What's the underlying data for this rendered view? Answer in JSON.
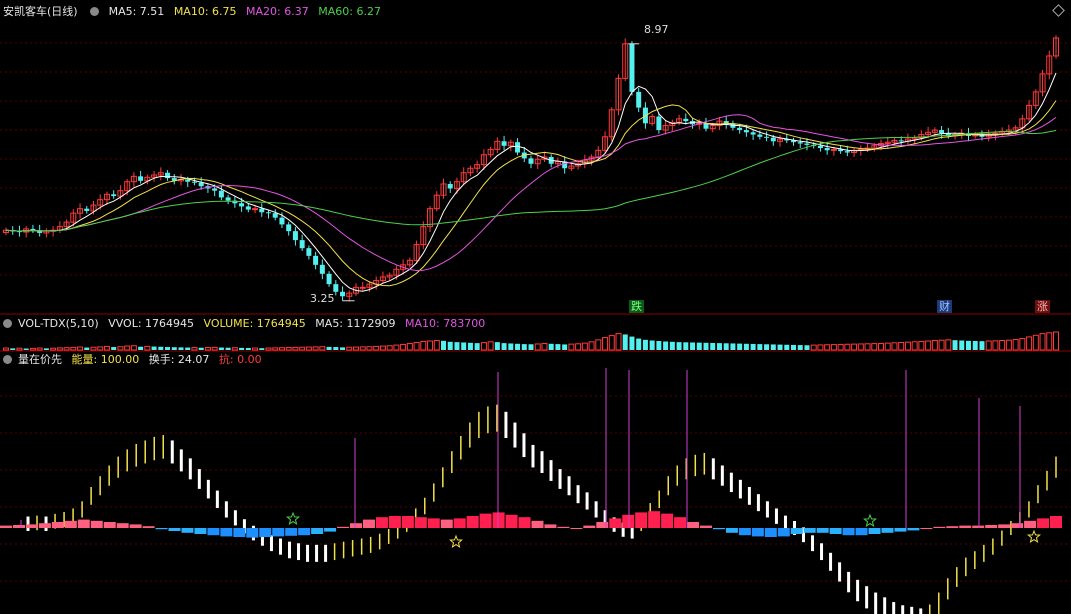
{
  "header": {
    "title": "安凯客车(日线)",
    "ma5": "MA5: 7.51",
    "ma10": "MA10: 6.75",
    "ma20": "MA20: 6.37",
    "ma60": "MA60: 6.27"
  },
  "volume_header": {
    "name": "VOL-TDX(5,10)",
    "vvol": "VVOL: 1764945",
    "volume": "VOLUME: 1764945",
    "ma5": "MA5: 1172909",
    "ma10": "MA10: 783700"
  },
  "indicator_header": {
    "name": "量在价先",
    "energy": "能量: 100.00",
    "turnover": "换手: 24.07",
    "kang": "抗: 0.00"
  },
  "price_annotations": {
    "high": "8.97",
    "low": "3.25"
  },
  "tags": {
    "die": "跌",
    "cai": "财",
    "zhang": "涨"
  },
  "colors": {
    "up": "#ff3b3b",
    "down": "#54f0f0",
    "ma5": "#ffffff",
    "ma10": "#f2e24a",
    "ma20": "#e455e4",
    "ma60": "#4cd04c",
    "grid": "#5a0000",
    "sep": "#8a0000"
  },
  "chart_data": [
    {
      "type": "candlestick",
      "title": "安凯客车(日线)",
      "ylim": [
        3.0,
        9.5
      ],
      "min_price": 3.25,
      "max_price": 8.97,
      "closes": [
        4.82,
        4.8,
        4.78,
        4.85,
        4.82,
        4.76,
        4.8,
        4.82,
        4.9,
        5.0,
        5.2,
        5.3,
        5.25,
        5.38,
        5.5,
        5.62,
        5.58,
        5.7,
        5.9,
        6.02,
        5.92,
        6.0,
        6.05,
        6.1,
        5.98,
        5.92,
        5.95,
        5.9,
        5.88,
        5.8,
        5.75,
        5.7,
        5.55,
        5.48,
        5.42,
        5.35,
        5.28,
        5.3,
        5.22,
        5.2,
        5.1,
        4.95,
        4.8,
        4.6,
        4.42,
        4.25,
        4.05,
        3.85,
        3.62,
        3.45,
        3.35,
        3.42,
        3.55,
        3.55,
        3.62,
        3.7,
        3.78,
        3.82,
        3.95,
        4.05,
        4.15,
        4.5,
        4.9,
        5.3,
        5.6,
        5.85,
        5.75,
        5.9,
        6.1,
        6.2,
        6.28,
        6.5,
        6.62,
        6.8,
        6.7,
        6.78,
        6.55,
        6.42,
        6.3,
        6.4,
        6.45,
        6.3,
        6.35,
        6.2,
        6.25,
        6.3,
        6.38,
        6.45,
        6.6,
        6.9,
        7.5,
        8.2,
        8.97,
        7.9,
        7.55,
        7.2,
        7.35,
        7.05,
        7.15,
        7.22,
        7.3,
        7.25,
        7.18,
        7.2,
        7.08,
        7.15,
        7.25,
        7.2,
        7.1,
        7.05,
        7.0,
        6.95,
        6.9,
        6.88,
        6.8,
        6.85,
        6.82,
        6.78,
        6.75,
        6.72,
        6.7,
        6.65,
        6.6,
        6.62,
        6.58,
        6.55,
        6.6,
        6.62,
        6.65,
        6.7,
        6.75,
        6.78,
        6.82,
        6.8,
        6.85,
        6.88,
        6.95,
        7.0,
        7.05,
        6.98,
        6.92,
        6.95,
        6.98,
        6.92,
        6.95,
        6.9,
        6.94,
        6.98,
        7.02,
        7.05,
        7.1,
        7.3,
        7.6,
        7.9,
        8.3,
        8.7,
        9.1
      ]
    },
    {
      "type": "bar",
      "title": "VOL-TDX(5,10)",
      "series": [
        {
          "name": "VOLUME",
          "values": [
            0.12,
            0.1,
            0.11,
            0.09,
            0.1,
            0.12,
            0.1,
            0.11,
            0.13,
            0.14,
            0.16,
            0.18,
            0.15,
            0.17,
            0.19,
            0.22,
            0.18,
            0.2,
            0.24,
            0.26,
            0.2,
            0.22,
            0.21,
            0.2,
            0.18,
            0.17,
            0.16,
            0.15,
            0.15,
            0.14,
            0.15,
            0.16,
            0.15,
            0.14,
            0.14,
            0.13,
            0.12,
            0.12,
            0.11,
            0.12,
            0.13,
            0.14,
            0.15,
            0.16,
            0.17,
            0.18,
            0.19,
            0.2,
            0.19,
            0.18,
            0.16,
            0.17,
            0.18,
            0.19,
            0.2,
            0.22,
            0.24,
            0.26,
            0.3,
            0.34,
            0.4,
            0.46,
            0.52,
            0.55,
            0.58,
            0.56,
            0.5,
            0.48,
            0.46,
            0.44,
            0.42,
            0.45,
            0.5,
            0.48,
            0.42,
            0.4,
            0.38,
            0.36,
            0.35,
            0.37,
            0.4,
            0.38,
            0.36,
            0.34,
            0.36,
            0.38,
            0.42,
            0.5,
            0.62,
            0.76,
            0.88,
            1.0,
            0.95,
            0.82,
            0.7,
            0.62,
            0.58,
            0.55,
            0.52,
            0.5,
            0.48,
            0.47,
            0.46,
            0.45,
            0.44,
            0.43,
            0.42,
            0.41,
            0.4,
            0.39,
            0.38,
            0.37,
            0.36,
            0.35,
            0.34,
            0.33,
            0.32,
            0.31,
            0.3,
            0.29,
            0.3,
            0.31,
            0.32,
            0.33,
            0.34,
            0.35,
            0.36,
            0.37,
            0.38,
            0.39,
            0.4,
            0.42,
            0.44,
            0.46,
            0.48,
            0.5,
            0.52,
            0.55,
            0.58,
            0.6,
            0.62,
            0.6,
            0.58,
            0.56,
            0.55,
            0.54,
            0.55,
            0.56,
            0.58,
            0.6,
            0.64,
            0.7,
            0.8,
            0.9,
            1.0,
            1.05,
            1.1
          ]
        }
      ]
    },
    {
      "type": "bar",
      "title": "量在价先",
      "series": [
        {
          "name": "能量",
          "values": [
            0.05,
            0.06,
            0.05,
            0.08,
            0.1,
            0.14,
            0.22,
            0.38,
            0.5,
            0.62,
            0.72,
            0.8,
            0.86,
            0.9,
            0.94,
            0.96,
            0.9,
            0.8,
            0.7,
            0.58,
            0.46,
            0.34,
            0.22,
            0.12,
            0.02,
            -0.06,
            -0.12,
            -0.18,
            -0.22,
            -0.26,
            -0.28,
            -0.3,
            -0.3,
            -0.3,
            -0.28,
            -0.26,
            -0.24,
            -0.22,
            -0.2,
            -0.16,
            -0.1,
            -0.04,
            0.04,
            0.14,
            0.26,
            0.42,
            0.6,
            0.78,
            0.95,
            1.1,
            1.22,
            1.28,
            1.3,
            1.22,
            1.1,
            0.98,
            0.85,
            0.78,
            0.68,
            0.58,
            0.5,
            0.4,
            0.32,
            0.22,
            0.12,
            0.04,
            -0.02,
            -0.04,
            0.05,
            0.2,
            0.34,
            0.5,
            0.62,
            0.7,
            0.74,
            0.76,
            0.7,
            0.62,
            0.54,
            0.46,
            0.38,
            0.3,
            0.22,
            0.14,
            0.06,
            0.0,
            -0.08,
            -0.18,
            -0.28,
            -0.4,
            -0.52,
            -0.64,
            -0.74,
            -0.82,
            -0.9,
            -0.96,
            -1.02,
            -1.06,
            -1.08,
            -1.1,
            -1.05,
            -0.9,
            -0.72,
            -0.58,
            -0.46,
            -0.38,
            -0.3,
            -0.22,
            -0.12,
            0.0,
            0.1,
            0.22,
            0.4,
            0.56,
            0.72
          ]
        },
        {
          "name": "换手",
          "values": [
            0.04,
            0.05,
            0.06,
            0.08,
            0.1,
            0.12,
            0.14,
            0.12,
            0.1,
            0.08,
            0.06,
            0.03,
            -0.02,
            -0.05,
            -0.08,
            -0.1,
            -0.12,
            -0.14,
            -0.15,
            -0.16,
            -0.15,
            -0.14,
            -0.13,
            -0.12,
            -0.1,
            -0.06,
            0.02,
            0.08,
            0.14,
            0.18,
            0.2,
            0.2,
            0.18,
            0.16,
            0.14,
            0.16,
            0.2,
            0.24,
            0.26,
            0.22,
            0.18,
            0.12,
            0.06,
            0.02,
            0.0,
            0.04,
            0.1,
            0.16,
            0.22,
            0.26,
            0.28,
            0.24,
            0.18,
            0.1,
            0.04,
            -0.02,
            -0.08,
            -0.12,
            -0.14,
            -0.15,
            -0.14,
            -0.1,
            -0.08,
            -0.08,
            -0.1,
            -0.12,
            -0.12,
            -0.1,
            -0.08,
            -0.06,
            -0.04,
            0.0,
            0.02,
            0.03,
            0.04,
            0.04,
            0.05,
            0.06,
            0.08,
            0.12,
            0.16,
            0.2
          ]
        }
      ]
    }
  ]
}
